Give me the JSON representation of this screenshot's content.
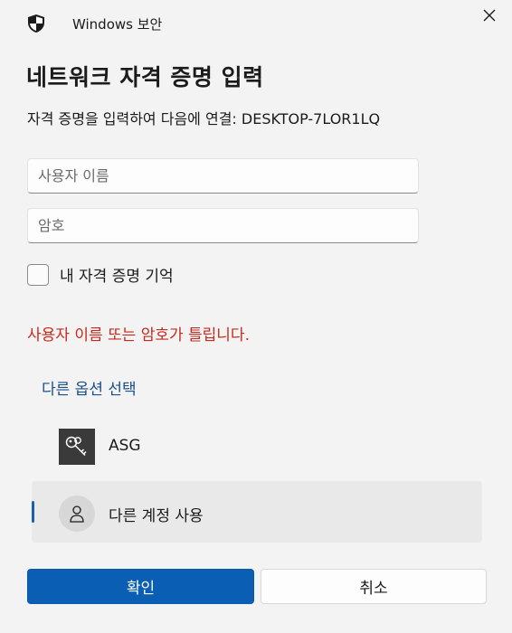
{
  "window": {
    "app_title": "Windows 보안",
    "icon": "shield-icon",
    "close_icon": "close-icon"
  },
  "dialog": {
    "heading": "네트워크 자격 증명 입력",
    "subtitle": "자격 증명을 입력하여 다음에 연결: DESKTOP-7LOR1LQ"
  },
  "form": {
    "username": {
      "value": "",
      "placeholder": "사용자 이름"
    },
    "password": {
      "value": "",
      "placeholder": "암호"
    },
    "remember": {
      "label": "내 자격 증명 기억",
      "checked": false
    }
  },
  "error": {
    "message": "사용자 이름 또는 암호가 틀립니다.",
    "color": "#c42b1c"
  },
  "more_choices": {
    "label": "다른 옵션 선택",
    "options": [
      {
        "label": "ASG",
        "icon": "key-icon",
        "selected": false
      },
      {
        "label": "다른 계정 사용",
        "icon": "person-icon",
        "selected": true
      }
    ]
  },
  "buttons": {
    "ok_label": "확인",
    "cancel_label": "취소"
  },
  "colors": {
    "accent": "#0a5fb4",
    "link": "#1a4f8a",
    "background": "#f3f3f3"
  }
}
